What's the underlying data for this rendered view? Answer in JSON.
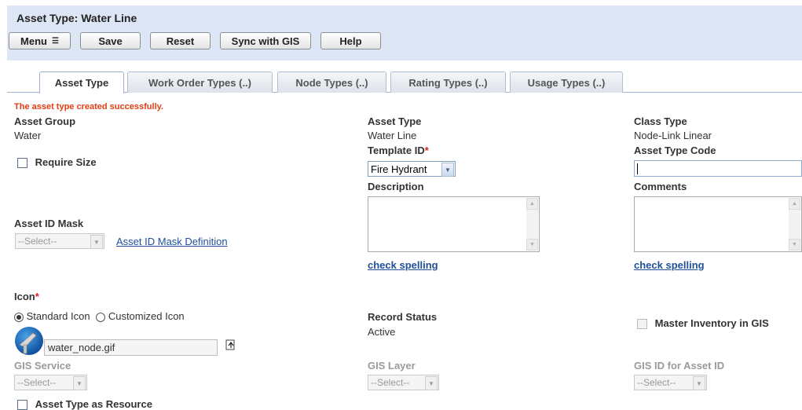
{
  "header": {
    "title": "Asset Type: Water Line"
  },
  "toolbar": {
    "menu": "Menu",
    "save": "Save",
    "reset": "Reset",
    "sync": "Sync with GIS",
    "help": "Help"
  },
  "tabs": [
    {
      "label": "Asset Type",
      "active": true
    },
    {
      "label": "Work Order Types (..)",
      "active": false
    },
    {
      "label": "Node Types (..)",
      "active": false
    },
    {
      "label": "Rating Types (..)",
      "active": false
    },
    {
      "label": "Usage Types (..)",
      "active": false
    }
  ],
  "message": "The asset type created successfully.",
  "form": {
    "asset_group": {
      "label": "Asset Group",
      "value": "Water"
    },
    "require_size": {
      "label": "Require Size",
      "checked": false
    },
    "asset_id_mask": {
      "label": "Asset ID Mask",
      "value": "--Select--",
      "link": "Asset ID Mask Definition"
    },
    "asset_type": {
      "label": "Asset Type",
      "value": "Water Line"
    },
    "template_id": {
      "label": "Template ID",
      "required": "*",
      "value": "Fire Hydrant"
    },
    "description": {
      "label": "Description",
      "value": "",
      "spell": "check spelling"
    },
    "class_type": {
      "label": "Class Type",
      "value": "Node-Link Linear"
    },
    "asset_type_code": {
      "label": "Asset Type Code",
      "value": ""
    },
    "comments": {
      "label": "Comments",
      "value": "",
      "spell": "check spelling"
    },
    "icon": {
      "label": "Icon",
      "required": "*",
      "standard": "Standard Icon",
      "custom": "Customized Icon",
      "selected": "standard",
      "file": "water_node.gif"
    },
    "record_status": {
      "label": "Record Status",
      "value": "Active"
    },
    "master_inventory": {
      "label": "Master Inventory in GIS",
      "checked": false
    },
    "gis_service": {
      "label": "GIS Service",
      "value": "--Select--"
    },
    "gis_layer": {
      "label": "GIS Layer",
      "value": "--Select--"
    },
    "gis_id": {
      "label": "GIS ID for Asset ID",
      "value": "--Select--"
    },
    "asset_type_resource": {
      "label": "Asset Type as Resource",
      "checked": false
    }
  },
  "colors": {
    "header_bg": "#dce6f4",
    "message": "#e53d12",
    "link": "#1f4f99",
    "required": "#d9231c"
  }
}
